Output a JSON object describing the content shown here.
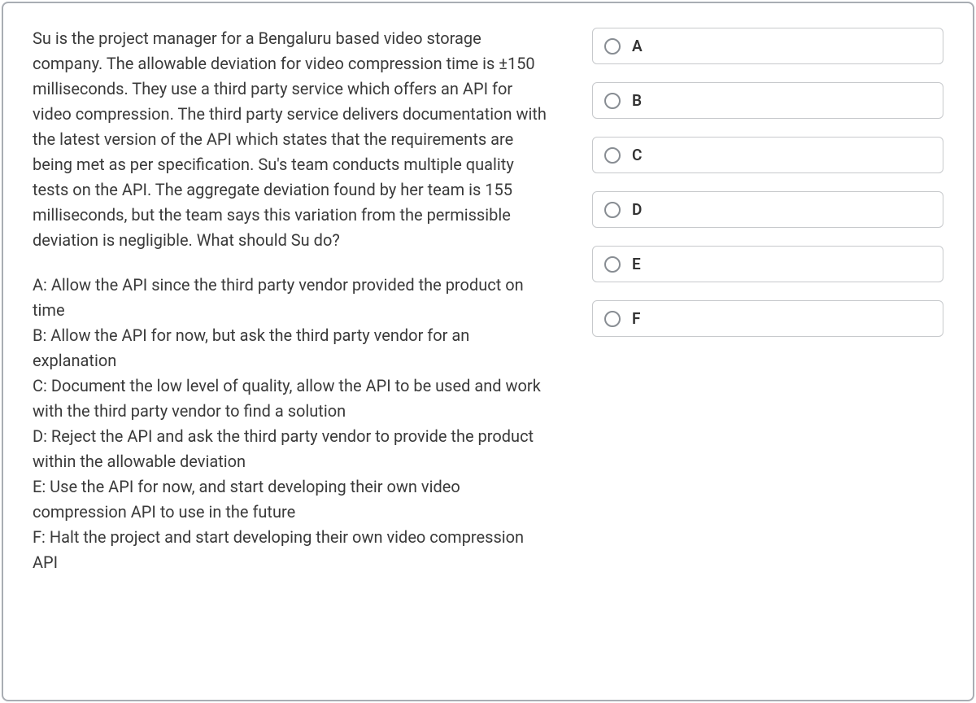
{
  "question": {
    "prompt": "Su is the project manager for a Bengaluru based video storage company. The allowable deviation for video compression time is ±150 milliseconds. They use a third party service which offers an API for video compression. The third party service delivers documentation with the latest version of the API which states that the requirements are being met as per specification. Su's team conducts multiple quality tests on the API. The aggregate deviation found by her team is 155 milliseconds, but the team says this variation from the permissible deviation is negligible. What should Su do?",
    "choice_descriptions": {
      "A": "A: Allow the API since the third party vendor provided the product on time",
      "B": "B: Allow the API for now, but ask the third party vendor for an explanation",
      "C": "C: Document the low level of quality, allow the API to be used and work with the third party vendor to find a solution",
      "D": "D: Reject the API and ask the third party vendor to provide the product within the allowable deviation",
      "E": "E: Use the API for now, and start developing their own video compression API to use in the future",
      "F": "F: Halt the project and start developing their own video compression API"
    }
  },
  "options": [
    {
      "label": "A"
    },
    {
      "label": "B"
    },
    {
      "label": "C"
    },
    {
      "label": "D"
    },
    {
      "label": "E"
    },
    {
      "label": "F"
    }
  ]
}
